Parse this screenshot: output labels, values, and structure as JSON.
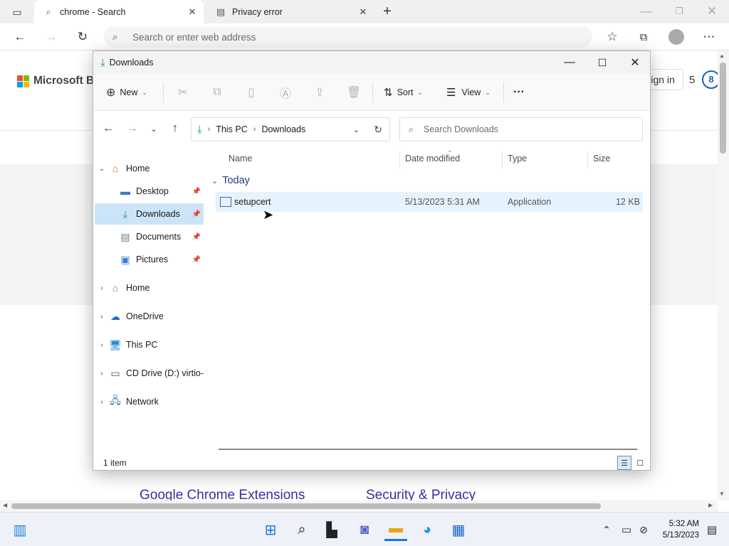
{
  "browser": {
    "tabs": [
      {
        "label": "chrome - Search",
        "icon": "search-icon",
        "active": true
      },
      {
        "label": "Privacy error",
        "icon": "page-icon",
        "active": false
      }
    ],
    "address_placeholder": "Search or enter web address"
  },
  "webpage": {
    "brand": "Microsoft Bing",
    "sign_in": "Sign in",
    "rewards_count": "5",
    "footer_links": [
      "Google Chrome Extensions",
      "Security & Privacy"
    ]
  },
  "explorer": {
    "title": "Downloads",
    "command_bar": {
      "new_label": "New",
      "sort_label": "Sort",
      "view_label": "View",
      "more_label": "···"
    },
    "breadcrumb": [
      "This PC",
      "Downloads"
    ],
    "search_placeholder": "Search Downloads",
    "nav_pane": [
      {
        "label": "Home",
        "icon": "home-icon",
        "level": 0,
        "expanded": true
      },
      {
        "label": "Desktop",
        "icon": "desktop-icon",
        "level": 1,
        "pinned": true
      },
      {
        "label": "Downloads",
        "icon": "download-icon",
        "level": 1,
        "pinned": true,
        "selected": true
      },
      {
        "label": "Documents",
        "icon": "documents-icon",
        "level": 1,
        "pinned": true
      },
      {
        "label": "Pictures",
        "icon": "pictures-icon",
        "level": 1,
        "pinned": true
      },
      {
        "label": "Home",
        "icon": "home-icon",
        "level": 0
      },
      {
        "label": "OneDrive",
        "icon": "onedrive-icon",
        "level": 0
      },
      {
        "label": "This PC",
        "icon": "pc-icon",
        "level": 0
      },
      {
        "label": "CD Drive (D:) virtio-",
        "icon": "cd-drive-icon",
        "level": 0
      },
      {
        "label": "Network",
        "icon": "network-icon",
        "level": 0
      }
    ],
    "columns": [
      "Name",
      "Date modified",
      "Type",
      "Size"
    ],
    "group_label": "Today",
    "files": [
      {
        "name": "setupcert",
        "date": "5/13/2023 5:31 AM",
        "type": "Application",
        "size": "12 KB"
      }
    ],
    "status": "1 item"
  },
  "taskbar": {
    "time": "5:32 AM",
    "date": "5/13/2023"
  },
  "colors": {
    "selection": "#cce4f7",
    "accent": "#0067c0",
    "download_green": "#17a05a"
  }
}
